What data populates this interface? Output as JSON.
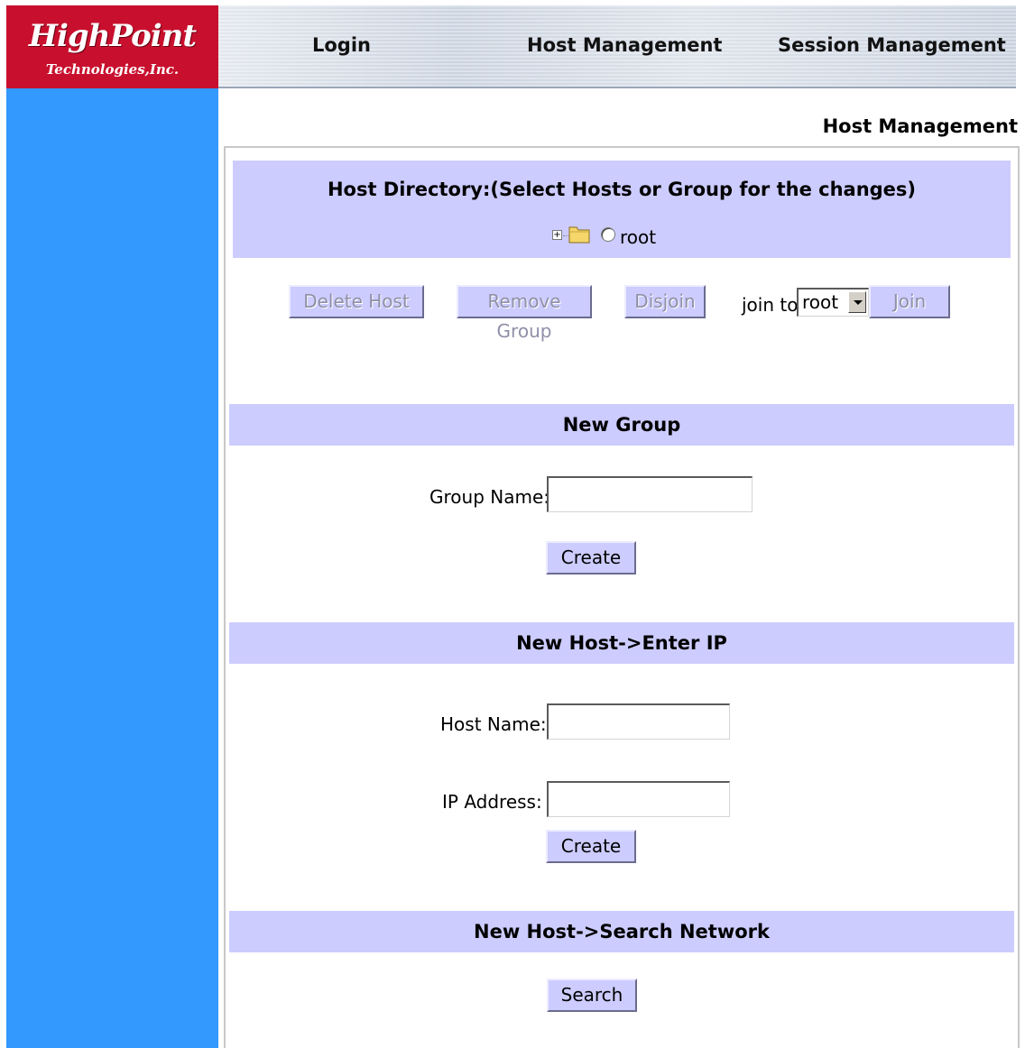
{
  "logo": {
    "name": "HighPoint",
    "tagline": "Technologies,Inc."
  },
  "nav": {
    "items": [
      "Login",
      "Host Management",
      "Session Management"
    ]
  },
  "page_title": "Host Management",
  "host_directory": {
    "header": "Host Directory:(Select Hosts or Group for the changes)",
    "tree_root_label": "root",
    "buttons": {
      "delete_host": "Delete Host",
      "remove_group": "Remove Group",
      "disjoin": "Disjoin",
      "join": "Join"
    },
    "join_to_label": "join to",
    "join_target_selected": "root"
  },
  "new_group": {
    "header": "New Group",
    "group_name_label": "Group Name:",
    "group_name_value": "",
    "create_label": "Create"
  },
  "new_host_ip": {
    "header": "New Host->Enter IP",
    "host_name_label": "Host Name:",
    "host_name_value": "",
    "ip_address_label": "IP Address:",
    "ip_address_value": "",
    "create_label": "Create"
  },
  "new_host_search": {
    "header": "New Host->Search Network",
    "search_label": "Search"
  },
  "colors": {
    "brand_red": "#c8102e",
    "sidebar_blue": "#3399ff",
    "section_lavender": "#ccccff"
  }
}
